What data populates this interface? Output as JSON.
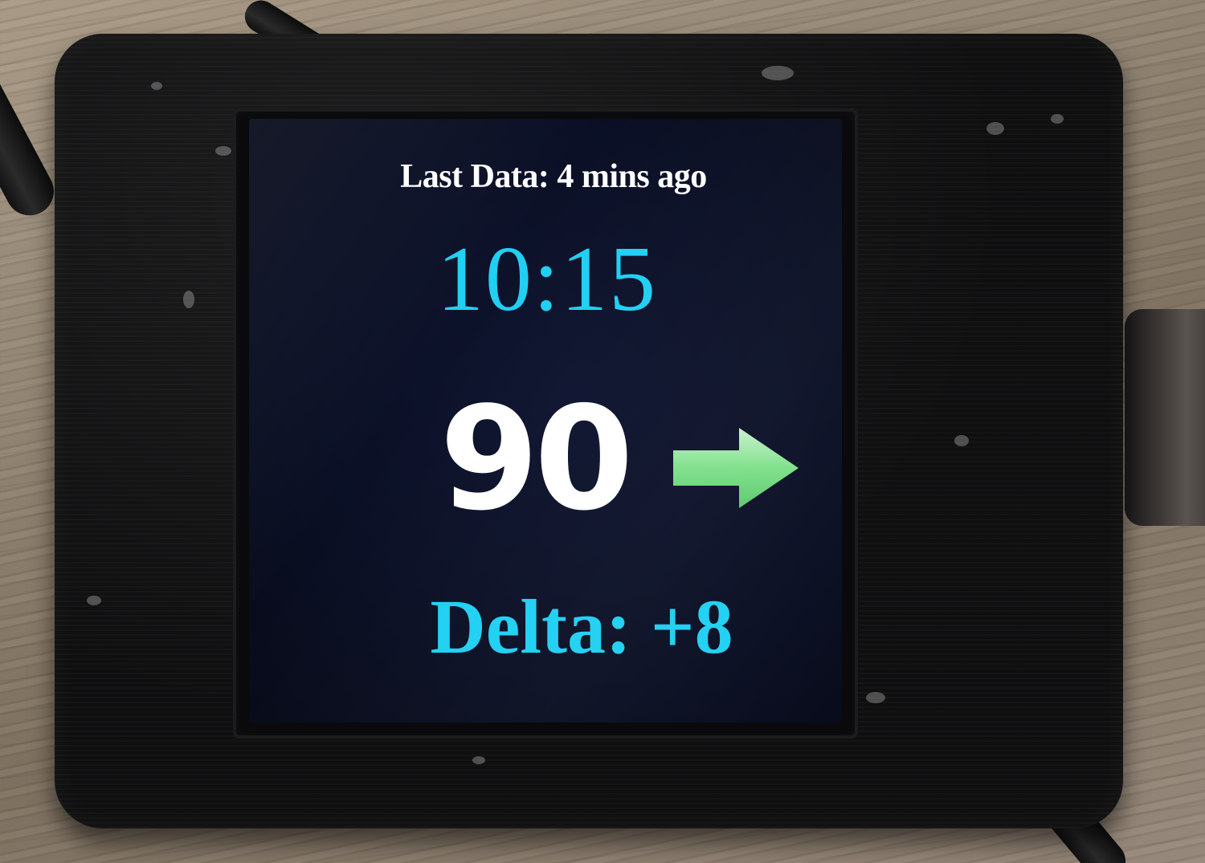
{
  "display": {
    "last_data": "Last Data: 4 mins ago",
    "time": "10:15",
    "glucose_value": "90",
    "trend_icon": "right-arrow-icon",
    "delta": "Delta: +8"
  },
  "colors": {
    "screen_background": "#0a0f24",
    "time_text": "#1fd0f2",
    "delta_text": "#1fd0f2",
    "glucose_text": "#ffffff",
    "header_text": "#ffffff",
    "trend_arrow": "#7ee08a"
  }
}
